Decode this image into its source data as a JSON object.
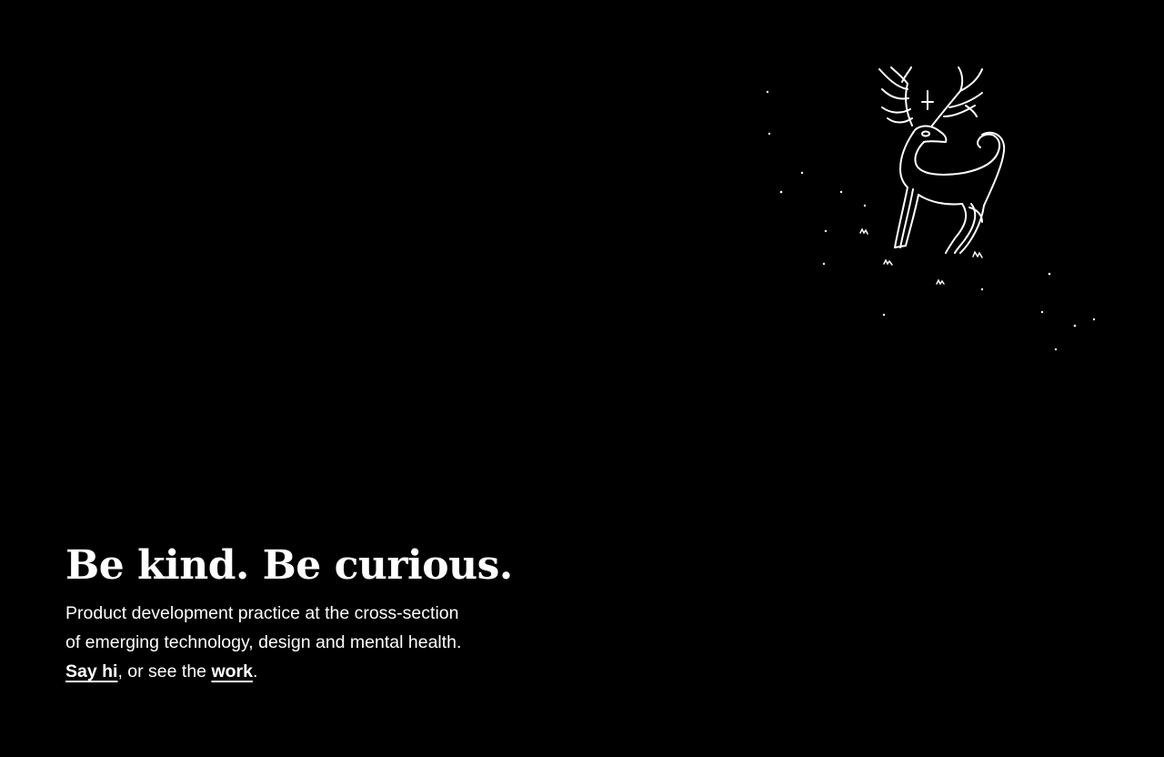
{
  "illustration": {
    "icon": "deer-icon",
    "stroke_color": "#ffffff"
  },
  "hero": {
    "headline": "Be kind. Be curious.",
    "description_line1": "Product development practice at the cross-section",
    "description_line2": "of emerging technology, design and mental health.",
    "say_hi_link": "Say hi",
    "middle_text": ", or see the ",
    "work_link": "work",
    "end_text": "."
  },
  "colors": {
    "background": "#000000",
    "text": "#ffffff"
  }
}
